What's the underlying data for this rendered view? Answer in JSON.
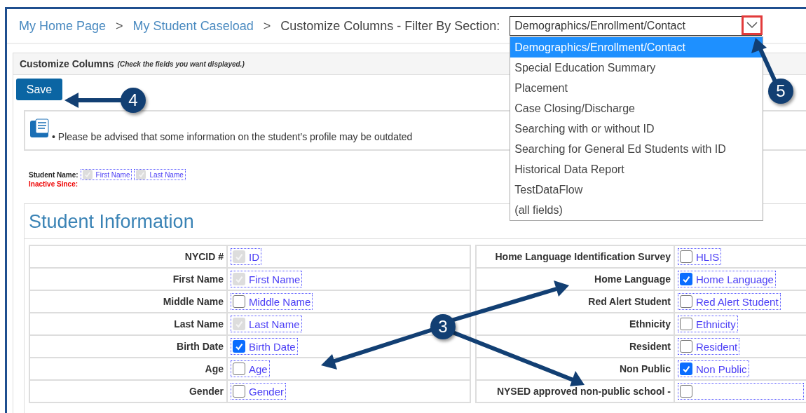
{
  "breadcrumb": {
    "links": [
      "My Home Page",
      "My Student Caseload"
    ],
    "separator": ">",
    "current": "Customize Columns - Filter By Section:"
  },
  "section_select": {
    "value": "Demographics/Enrollment/Contact",
    "expanded": true,
    "options": [
      {
        "label": "Demographics/Enrollment/Contact",
        "selected": true
      },
      {
        "label": "Special Education Summary",
        "selected": false
      },
      {
        "label": "Placement",
        "selected": false
      },
      {
        "label": "Case Closing/Discharge",
        "selected": false
      },
      {
        "label": "Searching with or without ID",
        "selected": false
      },
      {
        "label": "Searching for General Ed Students with ID",
        "selected": false
      },
      {
        "label": "Historical Data Report",
        "selected": false
      },
      {
        "label": "TestDataFlow",
        "selected": false
      },
      {
        "label": "(all fields)",
        "selected": false
      }
    ]
  },
  "panel": {
    "title": "Customize Columns",
    "hint": "(Check the fields you want displayed.)"
  },
  "save_button": "Save",
  "notice": "• Please be advised that some information on the student’s profile may be outdated",
  "student_name": {
    "label": "Student Name:",
    "fields": [
      {
        "label": "First Name",
        "checked": true,
        "disabled": true
      },
      {
        "label": "Last Name",
        "checked": true,
        "disabled": true
      }
    ],
    "inactive_label": "Inactive Since:"
  },
  "section": {
    "title": "Student Information",
    "left_rows": [
      {
        "label": "NYCID #",
        "option": "ID",
        "checked": true,
        "disabled": true
      },
      {
        "label": "First Name",
        "option": "First Name",
        "checked": true,
        "disabled": true
      },
      {
        "label": "Middle Name",
        "option": "Middle Name",
        "checked": false,
        "disabled": false
      },
      {
        "label": "Last Name",
        "option": "Last Name",
        "checked": true,
        "disabled": true
      },
      {
        "label": "Birth Date",
        "option": "Birth Date",
        "checked": true,
        "disabled": false
      },
      {
        "label": "Age",
        "option": "Age",
        "checked": false,
        "disabled": false
      },
      {
        "label": "Gender",
        "option": "Gender",
        "checked": false,
        "disabled": false
      }
    ],
    "right_rows": [
      {
        "label": "Home Language Identification Survey",
        "option": "HLIS",
        "checked": false,
        "disabled": false
      },
      {
        "label": "Home Language",
        "option": "Home Language",
        "checked": true,
        "disabled": false
      },
      {
        "label": "Red Alert Student",
        "option": "Red Alert Student",
        "checked": false,
        "disabled": false
      },
      {
        "label": "Ethnicity",
        "option": "Ethnicity",
        "checked": false,
        "disabled": false
      },
      {
        "label": "Resident",
        "option": "Resident",
        "checked": false,
        "disabled": false
      },
      {
        "label": "Non Public",
        "option": "Non Public",
        "checked": true,
        "disabled": false
      },
      {
        "label": "NYSED approved non-public school -",
        "checked": false,
        "disabled": false
      }
    ]
  },
  "callouts": [
    "3",
    "4",
    "5"
  ]
}
